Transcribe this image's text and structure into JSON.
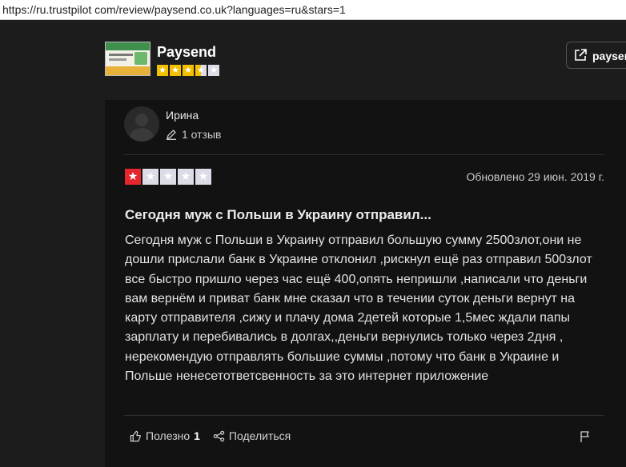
{
  "browser": {
    "url": "https://ru.trustpilot com/review/paysend.co.uk?languages=ru&stars=1"
  },
  "company": {
    "name": "Paysend",
    "rating_stars": 3.5,
    "visit_label": "paysend"
  },
  "review": {
    "reviewer_name": "Ирина",
    "review_count_label": "1 отзыв",
    "rating": 1,
    "date": "Обновлено 29 июн. 2019 г.",
    "title": "Сегодня муж с Польши в Украину отправил...",
    "body": "Сегодня муж с Польши в Украину отправил большую сумму 2500злот,они не дошли прислали банк в Украине отклонил ,рискнул ещё раз отправил 500злот все быстро пришло через час ещё 400,опять непришли ,написали что деньги вам вернём и приват банк мне сказал что в течении суток деньги вернут на карту отправителя ,сижу и плачу дома 2детей которые 1,5мес ждали папы зарплату и перебивались в долгах,,деньги вернулись только через 2дня , нерекомендую отправлять большие суммы ,потому что банк в Украине и Польше ненесетответсвенность за это интернет приложение",
    "useful_label": "Полезно",
    "useful_count": "1",
    "share_label": "Поделиться"
  },
  "colors": {
    "background": "#1c1c1c",
    "card": "#121212",
    "star_red": "#e4262e",
    "star_yellow": "#f2c000",
    "star_empty": "#dcdce6"
  },
  "icons": [
    "external-link-icon",
    "pencil-icon",
    "thumbs-up-icon",
    "share-icon",
    "flag-icon",
    "star-icon",
    "avatar-icon"
  ]
}
